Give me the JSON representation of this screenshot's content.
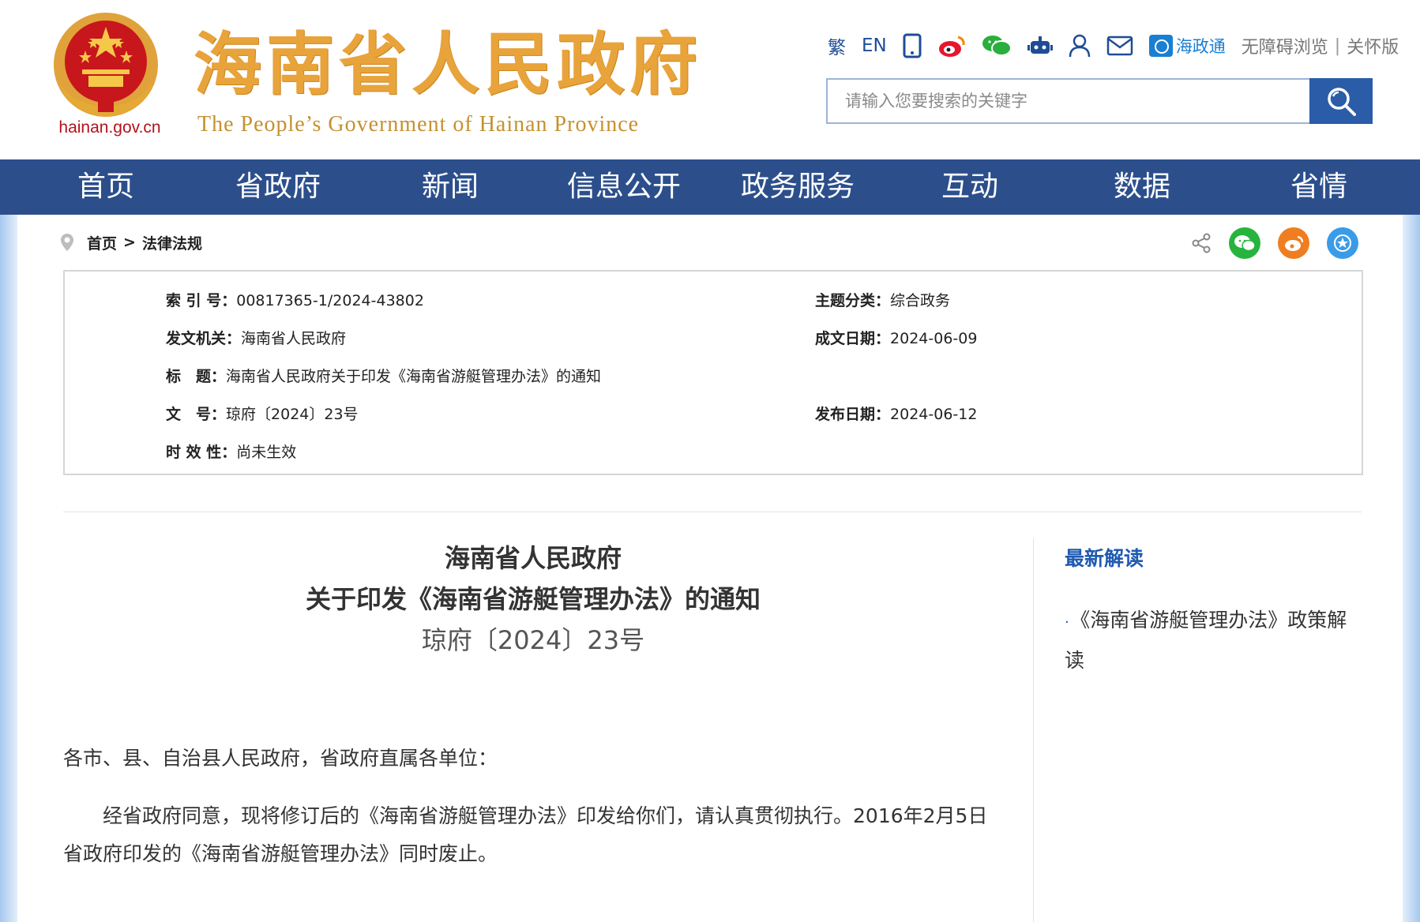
{
  "header": {
    "domain": "hainan.gov.cn",
    "title": "海南省人民政府",
    "subtitle": "The People’s Government  of Hainan Province",
    "toolbar": {
      "traditional": "繁",
      "english": "EN",
      "hzt_label": "海政通",
      "accessibility": "无障碍浏览",
      "separator": "|",
      "elderly": "关怀版"
    },
    "search": {
      "placeholder": "请输入您要搜索的关键字"
    }
  },
  "nav": [
    "首页",
    "省政府",
    "新闻",
    "信息公开",
    "政务服务",
    "互动",
    "数据",
    "省情"
  ],
  "breadcrumb": {
    "home": "首页",
    "sep": ">",
    "current": "法律法规"
  },
  "meta": {
    "index_label": "索 引 号：",
    "index_value": "00817365-1/2024-43802",
    "topic_label": "主题分类：",
    "topic_value": "综合政务",
    "issuer_label": "发文机关：",
    "issuer_value": "海南省人民政府",
    "date_label": "成文日期：",
    "date_value": "2024-06-09",
    "title_label": "标　题：",
    "title_value": "海南省人民政府关于印发《海南省游艇管理办法》的通知",
    "docno_label": "文　号：",
    "docno_value": "琼府〔2024〕23号",
    "pub_label": "发布日期：",
    "pub_value": "2024-06-12",
    "validity_label": "时 效 性：",
    "validity_value": "尚未生效"
  },
  "article": {
    "heading1": "海南省人民政府",
    "heading2": "关于印发《海南省游艇管理办法》的通知",
    "doc_number": "琼府〔2024〕23号",
    "salutation": "各市、县、自治县人民政府，省政府直属各单位：",
    "body": "　　经省政府同意，现将修订后的《海南省游艇管理办法》印发给你们，请认真贯彻执行。2016年2月5日省政府印发的《海南省游艇管理办法》同时废止。"
  },
  "sidebar": {
    "title": "最新解读",
    "items": [
      "《海南省游艇管理办法》政策解读"
    ]
  },
  "colors": {
    "nav": "#2c4f8c",
    "brand_gold": "#e8a33a",
    "link_blue": "#1f5ab1",
    "emblem_red": "#c8161d"
  }
}
